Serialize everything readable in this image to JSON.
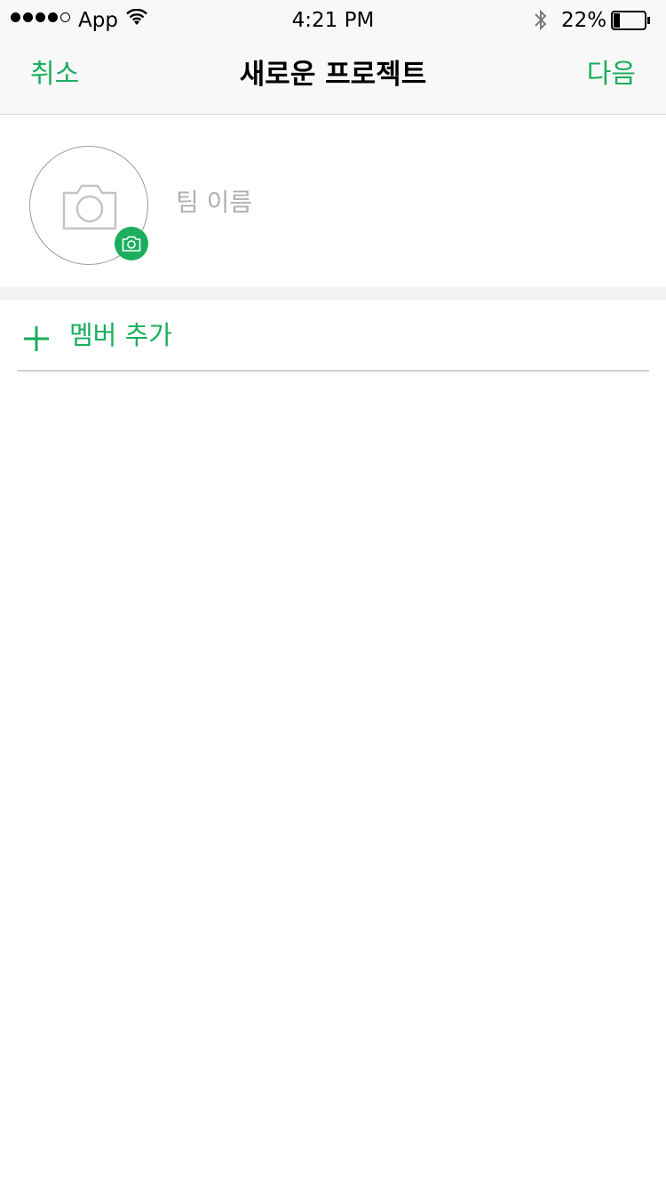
{
  "status_bar": {
    "carrier": "App",
    "time": "4:21 PM",
    "battery_percent": "22%",
    "battery_level": 0.22,
    "signal_bars_filled": 4,
    "signal_bars_total": 5,
    "icons": [
      "wifi-icon",
      "bluetooth-icon",
      "battery-icon"
    ]
  },
  "nav": {
    "cancel_label": "취소",
    "title": "새로운 프로젝트",
    "next_label": "다음"
  },
  "team": {
    "name_placeholder": "팀 이름",
    "name_value": "",
    "avatar_icon": "camera-icon",
    "badge_icon": "camera-icon"
  },
  "members": {
    "add_label": "멤버 추가",
    "add_icon": "plus-icon"
  },
  "colors": {
    "accent": "#1aae5e",
    "nav_background": "#f8f8f8",
    "placeholder": "#b0b0b0",
    "divider": "#d2d2d2"
  }
}
